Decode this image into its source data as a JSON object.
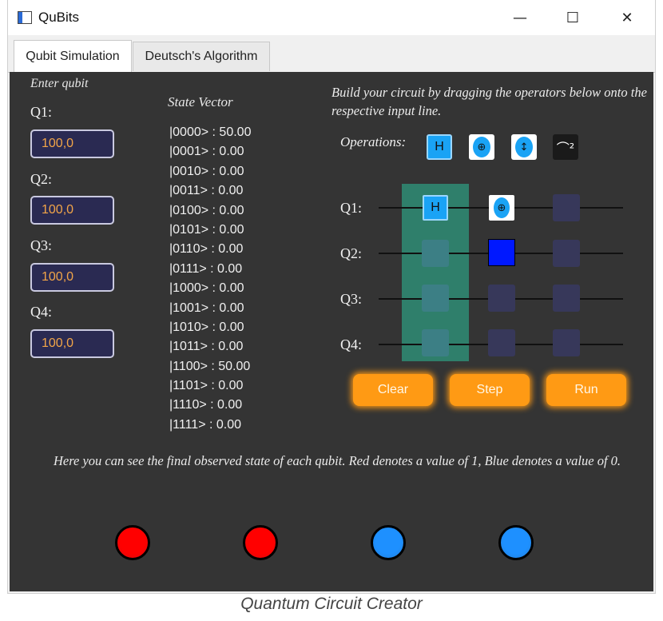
{
  "window": {
    "title": "QuBits",
    "controls": {
      "minimize": "—",
      "maximize": "☐",
      "close": "✕"
    }
  },
  "tabs": [
    {
      "label": "Qubit Simulation",
      "active": true
    },
    {
      "label": "Deutsch's Algorithm",
      "active": false
    }
  ],
  "input_panel": {
    "heading": "Enter qubit",
    "qubits": [
      {
        "label": "Q1:",
        "value": "100,0"
      },
      {
        "label": "Q2:",
        "value": "100,0"
      },
      {
        "label": "Q3:",
        "value": "100,0"
      },
      {
        "label": "Q4:",
        "value": "100,0"
      }
    ]
  },
  "state_vector": {
    "title": "State Vector",
    "entries": [
      "|0000> : 50.00",
      "|0001> : 0.00",
      "|0010> : 0.00",
      "|0011> : 0.00",
      "|0100> : 0.00",
      "|0101> : 0.00",
      "|0110> : 0.00",
      "|0111> : 0.00",
      "|1000> : 0.00",
      "|1001> : 0.00",
      "|1010> : 0.00",
      "|1011> : 0.00",
      "|1100> : 50.00",
      "|1101> : 0.00",
      "|1110> : 0.00",
      "|1111> : 0.00"
    ]
  },
  "circuit": {
    "instructions": "Build your circuit by dragging the operators below onto the respective input line.",
    "operations_label": "Operations:",
    "operations": [
      {
        "icon": "hadamard-gate-icon",
        "label": "H"
      },
      {
        "icon": "control-dot-icon",
        "label": "⊕"
      },
      {
        "icon": "swap-icon",
        "label": "↕"
      },
      {
        "icon": "measure-icon",
        "label": "⌒²"
      }
    ],
    "wire_labels": [
      "Q1:",
      "Q2:",
      "Q3:",
      "Q4:"
    ],
    "placed": {
      "hadamard_label": "H",
      "control_label": "⊕"
    },
    "buttons": {
      "clear": "Clear",
      "step": "Step",
      "run": "Run"
    }
  },
  "results": {
    "text": "Here you can see the final observed state of each qubit. Red denotes a value of 1, Blue denotes a value of 0.",
    "states": [
      1,
      1,
      0,
      0
    ],
    "colors": {
      "one": "#ff0000",
      "zero": "#1e90ff"
    }
  },
  "caption": "Quantum Circuit Creator"
}
